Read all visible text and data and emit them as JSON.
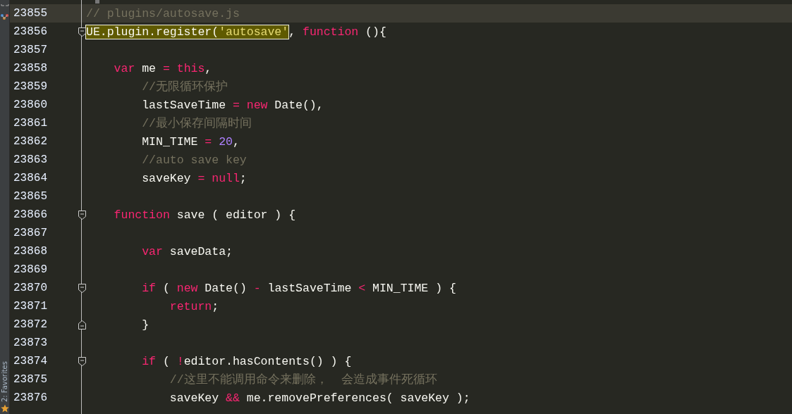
{
  "sidebar": {
    "bottom_tab": {
      "label": "2: Favorites"
    }
  },
  "editor": {
    "lines": [
      {
        "number": "23855",
        "current": true,
        "fold_start": false,
        "fold_end": false,
        "tokens": [
          {
            "kind": "comment",
            "text": "// plugins/autosave.js"
          }
        ]
      },
      {
        "number": "23856",
        "current": false,
        "fold_start": true,
        "fold_end": false,
        "tokens": [
          {
            "kind": "match",
            "children": [
              {
                "kind": "plain",
                "text": "UE.plugin.register("
              },
              {
                "kind": "str",
                "text": "'autosave'"
              }
            ]
          },
          {
            "kind": "plain",
            "text": ", "
          },
          {
            "kind": "kw",
            "text": "function"
          },
          {
            "kind": "plain",
            "text": " (){"
          }
        ]
      },
      {
        "number": "23857",
        "current": false,
        "fold_start": false,
        "fold_end": false
      },
      {
        "number": "23858",
        "current": false,
        "fold_start": false,
        "fold_end": false,
        "tokens": [
          {
            "kind": "kw",
            "text": "    var"
          },
          {
            "kind": "plain",
            "text": " me "
          },
          {
            "kind": "op",
            "text": "="
          },
          {
            "kind": "kw",
            "text": " this"
          },
          {
            "kind": "plain",
            "text": ","
          }
        ]
      },
      {
        "number": "23859",
        "current": false,
        "fold_start": false,
        "fold_end": false,
        "tokens": [
          {
            "kind": "comment",
            "text": "        //无限循环保护"
          }
        ]
      },
      {
        "number": "23860",
        "current": false,
        "fold_start": false,
        "fold_end": false,
        "tokens": [
          {
            "kind": "plain",
            "text": "        lastSaveTime "
          },
          {
            "kind": "op",
            "text": "="
          },
          {
            "kind": "kw",
            "text": " new"
          },
          {
            "kind": "plain",
            "text": " Date(),"
          }
        ]
      },
      {
        "number": "23861",
        "current": false,
        "fold_start": false,
        "fold_end": false,
        "tokens": [
          {
            "kind": "comment",
            "text": "        //最小保存间隔时间"
          }
        ]
      },
      {
        "number": "23862",
        "current": false,
        "fold_start": false,
        "fold_end": false,
        "tokens": [
          {
            "kind": "plain",
            "text": "        MIN_TIME "
          },
          {
            "kind": "op",
            "text": "="
          },
          {
            "kind": "num",
            "text": " 20"
          },
          {
            "kind": "plain",
            "text": ","
          }
        ]
      },
      {
        "number": "23863",
        "current": false,
        "fold_start": false,
        "fold_end": false,
        "tokens": [
          {
            "kind": "comment",
            "text": "        //auto save key"
          }
        ]
      },
      {
        "number": "23864",
        "current": false,
        "fold_start": false,
        "fold_end": false,
        "tokens": [
          {
            "kind": "plain",
            "text": "        saveKey "
          },
          {
            "kind": "op",
            "text": "="
          },
          {
            "kind": "kw",
            "text": " null"
          },
          {
            "kind": "plain",
            "text": ";"
          }
        ]
      },
      {
        "number": "23865",
        "current": false,
        "fold_start": false,
        "fold_end": false
      },
      {
        "number": "23866",
        "current": false,
        "fold_start": true,
        "fold_end": false,
        "tokens": [
          {
            "kind": "kw",
            "text": "    function"
          },
          {
            "kind": "plain",
            "text": " save ( editor ) {"
          }
        ]
      },
      {
        "number": "23867",
        "current": false,
        "fold_start": false,
        "fold_end": false
      },
      {
        "number": "23868",
        "current": false,
        "fold_start": false,
        "fold_end": false,
        "tokens": [
          {
            "kind": "kw",
            "text": "        var"
          },
          {
            "kind": "plain",
            "text": " saveData;"
          }
        ]
      },
      {
        "number": "23869",
        "current": false,
        "fold_start": false,
        "fold_end": false
      },
      {
        "number": "23870",
        "current": false,
        "fold_start": true,
        "fold_end": false,
        "tokens": [
          {
            "kind": "kw",
            "text": "        if"
          },
          {
            "kind": "plain",
            "text": " ( "
          },
          {
            "kind": "kw",
            "text": "new"
          },
          {
            "kind": "plain",
            "text": " Date() "
          },
          {
            "kind": "op",
            "text": "-"
          },
          {
            "kind": "plain",
            "text": " lastSaveTime "
          },
          {
            "kind": "op",
            "text": "<"
          },
          {
            "kind": "plain",
            "text": " MIN_TIME ) {"
          }
        ]
      },
      {
        "number": "23871",
        "current": false,
        "fold_start": false,
        "fold_end": false,
        "tokens": [
          {
            "kind": "kw",
            "text": "            return"
          },
          {
            "kind": "plain",
            "text": ";"
          }
        ]
      },
      {
        "number": "23872",
        "current": false,
        "fold_start": false,
        "fold_end": true,
        "tokens": [
          {
            "kind": "plain",
            "text": "        }"
          }
        ]
      },
      {
        "number": "23873",
        "current": false,
        "fold_start": false,
        "fold_end": false
      },
      {
        "number": "23874",
        "current": false,
        "fold_start": true,
        "fold_end": false,
        "tokens": [
          {
            "kind": "kw",
            "text": "        if"
          },
          {
            "kind": "plain",
            "text": " ( "
          },
          {
            "kind": "op",
            "text": "!"
          },
          {
            "kind": "plain",
            "text": "editor.hasContents() ) {"
          }
        ]
      },
      {
        "number": "23875",
        "current": false,
        "fold_start": false,
        "fold_end": false,
        "tokens": [
          {
            "kind": "comment",
            "text": "            //这里不能调用命令来删除，  会造成事件死循环"
          }
        ]
      },
      {
        "number": "23876",
        "current": false,
        "fold_start": false,
        "fold_end": false,
        "tokens": [
          {
            "kind": "plain",
            "text": "            saveKey "
          },
          {
            "kind": "op",
            "text": "&&"
          },
          {
            "kind": "plain",
            "text": " me.removePreferences( saveKey );"
          }
        ]
      }
    ]
  }
}
